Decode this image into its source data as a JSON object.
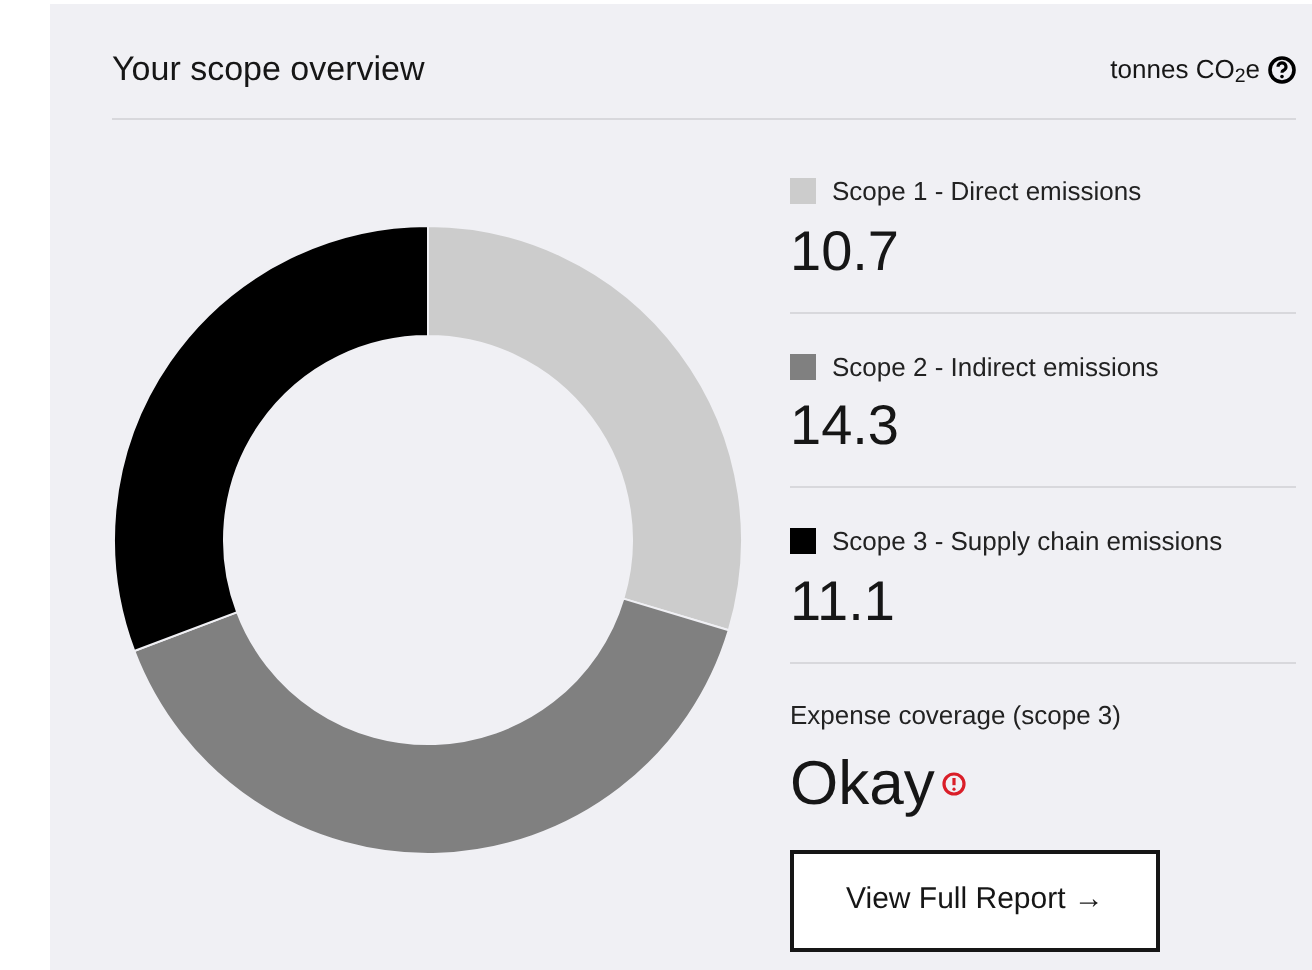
{
  "header": {
    "title": "Your scope overview",
    "unit": "tonnes CO$_{2}$e"
  },
  "scopes": [
    {
      "label": "Scope 1 - Direct emissions",
      "value": "10.7",
      "color": "#cccccc"
    },
    {
      "label": "Scope 2 - Indirect emissions",
      "value": "14.3",
      "color": "#808080"
    },
    {
      "label": "Scope 3 - Supply chain emissions",
      "value": "11.1",
      "color": "#000000"
    }
  ],
  "coverage": {
    "label": "Expense coverage (scope 3)",
    "status": "Okay",
    "warning": true
  },
  "button": "View Full Report →"
}
